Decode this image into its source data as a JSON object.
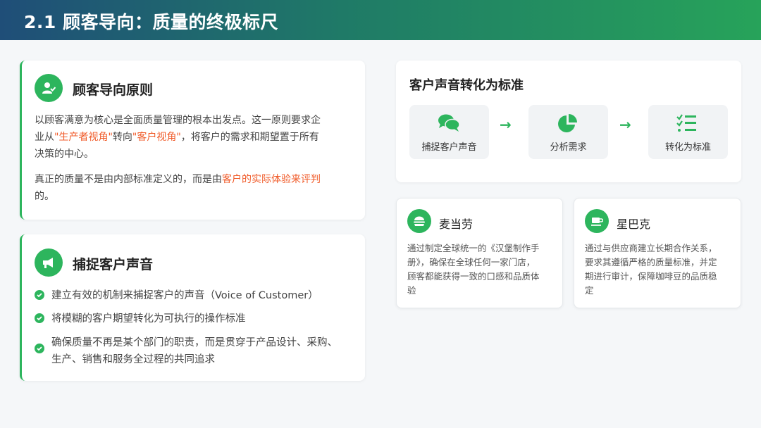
{
  "header": {
    "title": "2.1 顾客导向：质量的终极标尺"
  },
  "principle": {
    "title": "顾客导向原则",
    "p1_a": "以顾客满意为核心是全面质量管理的根本出发点。这一原则要求企",
    "p1_b_pre": "业从",
    "p1_b_hl1": "\"生产者视角\"",
    "p1_b_mid": "转向",
    "p1_b_hl2": "\"客户视角\"",
    "p1_b_post": "，将客户的需求和期望置于所有",
    "p1_c": "决策的中心。",
    "p2_a_pre": "真正的质量不是由内部标准定义的，而是由",
    "p2_a_hl": "客户的实际体验来评判",
    "p2_b": "的。"
  },
  "capture": {
    "title": "捕捉客户声音",
    "items": [
      {
        "lines": [
          "建立有效的机制来捕捉客户的声音（Voice of Customer）"
        ]
      },
      {
        "lines": [
          "将模糊的客户期望转化为可执行的操作标准"
        ]
      },
      {
        "lines": [
          "确保质量不再是某个部门的职责，而是贯穿于产品设计、采购、",
          "生产、销售和服务全过程的共同追求"
        ]
      }
    ]
  },
  "flow": {
    "title": "客户声音转化为标准",
    "steps": [
      {
        "label": "捕捉客户声音",
        "icon": "comments-icon"
      },
      {
        "label": "分析需求",
        "icon": "pie-chart-icon"
      },
      {
        "label": "转化为标准",
        "icon": "list-check-icon"
      }
    ],
    "arrow": "→"
  },
  "cases": [
    {
      "name": "麦当劳",
      "icon": "burger-icon",
      "lines": [
        "通过制定全球统一的《汉堡制作手",
        "册》，确保在全球任何一家门店，",
        "顾客都能获得一致的口感和品质体",
        "验"
      ]
    },
    {
      "name": "星巴克",
      "icon": "coffee-icon",
      "lines": [
        "通过与供应商建立长期合作关系，",
        "要求其遵循严格的质量标准，并定",
        "期进行审计，保障咖啡豆的品质稳",
        "定"
      ]
    }
  ],
  "colors": {
    "accent": "#2db55d",
    "highlight": "#f05a28"
  }
}
